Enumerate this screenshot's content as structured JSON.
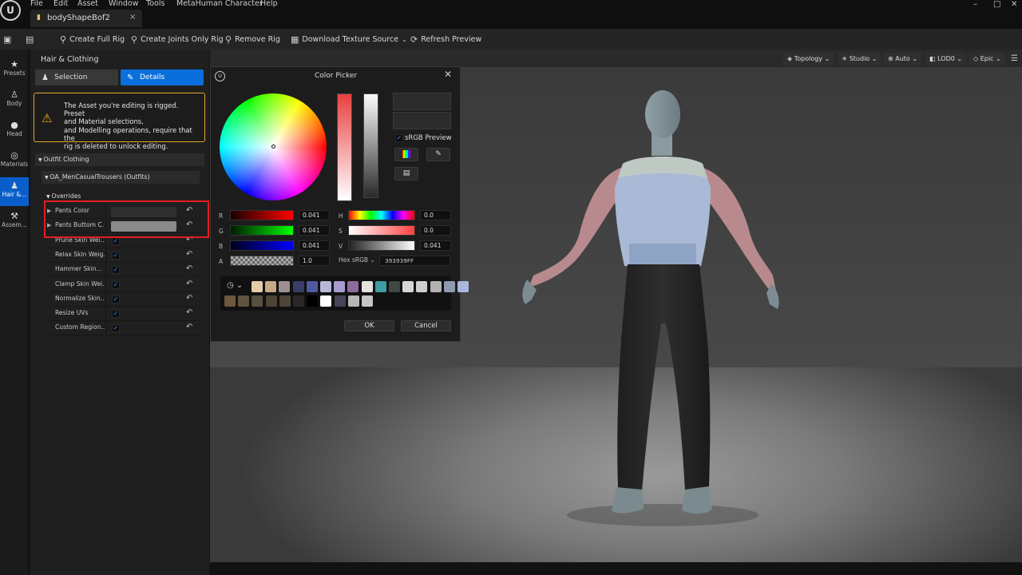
{
  "menubar": {
    "logo": "U",
    "items": [
      "File",
      "Edit",
      "Asset",
      "Window",
      "Tools",
      "MetaHuman Character",
      "Help"
    ],
    "tab_title": "bodyShapeBof2",
    "tab_close": "×",
    "window_controls": [
      "–",
      "□",
      "✕"
    ]
  },
  "toolbar": {
    "create_full_rig": "Create Full Rig",
    "create_joints_only_rig": "Create Joints Only Rig",
    "remove_rig": "Remove Rig",
    "download_texture_source": "Download Texture Source",
    "refresh_preview": "Refresh Preview"
  },
  "leftstrip": [
    {
      "label": "Presets",
      "icon": "star-icon"
    },
    {
      "label": "Body",
      "icon": "body-icon"
    },
    {
      "label": "Head",
      "icon": "head-icon"
    },
    {
      "label": "Materials",
      "icon": "materials-icon"
    },
    {
      "label": "Hair &...",
      "icon": "hair-clothing-icon"
    },
    {
      "label": "Assem...",
      "icon": "hammer-icon"
    }
  ],
  "panel": {
    "title": "Hair & Clothing",
    "tab_selection": "Selection",
    "tab_details": "Details",
    "warning_line1": "The Asset you're editing is rigged. Preset",
    "warning_line2": "and Material selections,",
    "warning_line3": "and Modelling operations, require that the",
    "warning_line4": "rig is deleted to unlock editing.",
    "section_outfit": "Outfit Clothing",
    "section_item": "OA_MenCasualTrousers (Outfits)",
    "section_overrides": "Overrides",
    "rows": [
      {
        "label": "Pants Color",
        "type": "color",
        "color": "#2f2f2f"
      },
      {
        "label": "Pants Buttom C...",
        "type": "color",
        "color": "#8a8a8a"
      },
      {
        "label": "Prune Skin Wei...",
        "type": "checkbox",
        "checked": true
      },
      {
        "label": "Relax Skin Weig...",
        "type": "checkbox",
        "checked": true
      },
      {
        "label": "Hammer Skin...",
        "type": "checkbox",
        "checked": true
      },
      {
        "label": "Clamp Skin Wei...",
        "type": "checkbox",
        "checked": true
      },
      {
        "label": "Normalize Skin...",
        "type": "checkbox",
        "checked": true
      },
      {
        "label": "Resize UVs",
        "type": "checkbox",
        "checked": true
      },
      {
        "label": "Custom Region...",
        "type": "checkbox",
        "checked": true
      }
    ]
  },
  "viewport_toolbar": [
    "Topology",
    "Studio",
    "Auto",
    "LOD0",
    "Epic"
  ],
  "color_picker": {
    "title": "Color Picker",
    "srgb_preview": "sRGB Preview",
    "channels": {
      "R": "0.041",
      "G": "0.041",
      "B": "0.041",
      "A": "1.0",
      "H": "0.0",
      "S": "0.0",
      "V": "0.041"
    },
    "hex_label": "Hex sRGB",
    "hex_value": "393939FF",
    "ok": "OK",
    "cancel": "Cancel",
    "swatches": [
      "#e7c9a7",
      "#c8a987",
      "#9c8f92",
      "#383e66",
      "#4f5aa0",
      "#b7b8d9",
      "#a89cce",
      "#8c6a9a",
      "#e6e2e0",
      "#3d9da0",
      "#3e4844",
      "#d6d6d6",
      "#cfcfcf",
      "#b2b2b2",
      "#8f99ad",
      "#a9b7dc",
      "#6d5a3c",
      "#5f533d",
      "#564f3f",
      "#4d4337",
      "#4e4437",
      "#2b2727",
      "#000000",
      "#ffffff",
      "#48435a",
      "#b7b7b7",
      "#c5c5c5"
    ]
  }
}
